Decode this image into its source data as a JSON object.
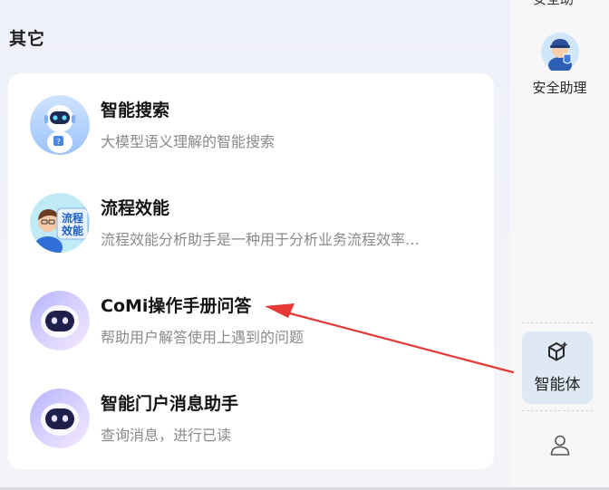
{
  "section": {
    "title": "其它"
  },
  "agents": [
    {
      "name": "智能搜索",
      "desc": "大模型语义理解的智能搜索",
      "avatar_icon": "robot-search-avatar-icon",
      "badge": ""
    },
    {
      "name": "流程效能",
      "desc": "流程效能分析助手是一种用于分析业务流程效率…",
      "avatar_icon": "process-efficiency-avatar-icon",
      "badge": "流程效能"
    },
    {
      "name": "CoMi操作手册问答",
      "desc": "帮助用户解答使用上遇到的问题",
      "avatar_icon": "comi-bot-avatar-icon",
      "badge": ""
    },
    {
      "name": "智能门户消息助手",
      "desc": "查询消息，进行已读",
      "avatar_icon": "comi-bot-avatar-icon",
      "badge": ""
    }
  ],
  "rail": {
    "top_fragment": "安全助",
    "security_assistant_label": "安全助理",
    "agents_tab_label": "智能体",
    "icons": {
      "security": "security-officer-avatar-icon",
      "agents": "sparkle-cube-icon",
      "user": "user-icon"
    }
  },
  "annotation": {
    "arrow_color": "#e53935"
  },
  "colors": {
    "card_bg": "#ffffff",
    "page_bg": "#eef0fa",
    "active_tab_bg": "#dfe9f6",
    "muted_text": "#8a8a8a"
  }
}
